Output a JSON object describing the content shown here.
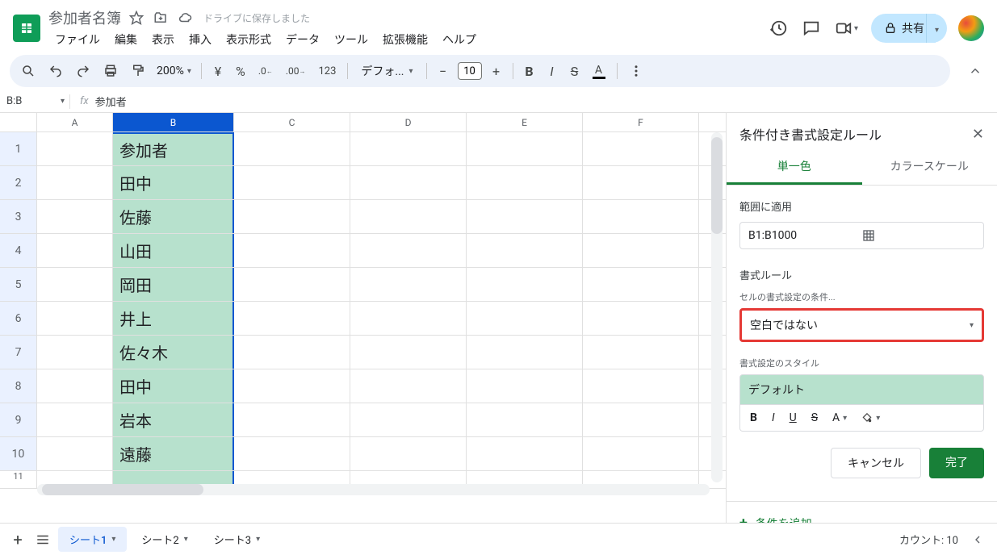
{
  "header": {
    "doc_title": "参加者名簿",
    "drive_message": "ドライブに保存しました",
    "share_label": "共有",
    "menu": [
      "ファイル",
      "編集",
      "表示",
      "挿入",
      "表示形式",
      "データ",
      "ツール",
      "拡張機能",
      "ヘルプ"
    ]
  },
  "toolbar": {
    "zoom": "200%",
    "currency": "¥",
    "percent": "%",
    "dec_dec": ".0",
    "inc_dec": ".00",
    "num_fmt": "123",
    "font": "デフォ...",
    "font_size": "10"
  },
  "namebox": {
    "ref": "B:B",
    "formula": "参加者"
  },
  "grid": {
    "columns": [
      "A",
      "B",
      "C",
      "D",
      "E",
      "F"
    ],
    "selected_col": "B",
    "rows": [
      {
        "n": "1",
        "b": "参加者"
      },
      {
        "n": "2",
        "b": "田中"
      },
      {
        "n": "3",
        "b": "佐藤"
      },
      {
        "n": "4",
        "b": "山田"
      },
      {
        "n": "5",
        "b": "岡田"
      },
      {
        "n": "6",
        "b": "井上"
      },
      {
        "n": "7",
        "b": "佐々木"
      },
      {
        "n": "8",
        "b": "田中"
      },
      {
        "n": "9",
        "b": "岩本"
      },
      {
        "n": "10",
        "b": "遠藤"
      }
    ]
  },
  "panel": {
    "title": "条件付き書式設定ルール",
    "tabs": {
      "single": "単一色",
      "scale": "カラースケール"
    },
    "range_label": "範囲に適用",
    "range_value": "B1:B1000",
    "rule_label": "書式ルール",
    "condition_label": "セルの書式設定の条件...",
    "condition_value": "空白ではない",
    "style_label": "書式設定のスタイル",
    "style_preview": "デフォルト",
    "cancel": "キャンセル",
    "done": "完了",
    "add_rule": "条件を追加"
  },
  "footer": {
    "sheets": [
      "シート1",
      "シート2",
      "シート3"
    ],
    "active_sheet": 0,
    "count_label": "カウント: 10"
  }
}
